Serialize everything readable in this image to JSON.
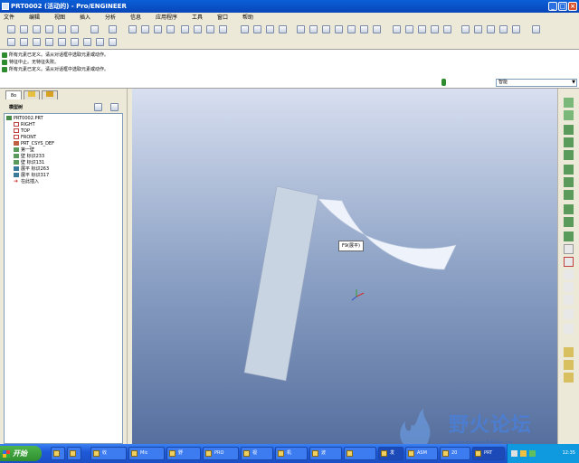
{
  "window": {
    "title": "PRT0002 (活动的) - Pro/ENGINEER"
  },
  "menu": [
    "文件",
    "编辑",
    "视图",
    "插入",
    "分析",
    "信息",
    "应用程序",
    "工具",
    "窗口",
    "帮助"
  ],
  "messages": [
    "所有元素已定义。请从对话框中选取元素或动作。",
    "特征中止。无特征失败。",
    "所有元素已定义。请从对话框中选取元素或动作。"
  ],
  "filter": {
    "value": "智能"
  },
  "panel": {
    "tabs": [
      "8o",
      "",
      ""
    ],
    "header": "模型树",
    "tree": [
      "PRT0002.PRT",
      "RIGHT",
      "TOP",
      "FRONT",
      "PRT_CSYS_DEF",
      "第一壁",
      "壁 标识233",
      "壁 标识131",
      "展平 标识263",
      "展平 标识317",
      "在此插入"
    ]
  },
  "viewport": {
    "tooltip": "F9(展平)"
  },
  "taskbar": {
    "start": "开始",
    "items": [
      "收",
      "Mic",
      "野",
      "PRO",
      "视",
      "机",
      "波",
      "",
      "发",
      "ASM",
      "20",
      "PRT"
    ],
    "clock": "12:35"
  },
  "watermark": {
    "title": "野火论坛",
    "url": "www.proewildfire.cn"
  }
}
